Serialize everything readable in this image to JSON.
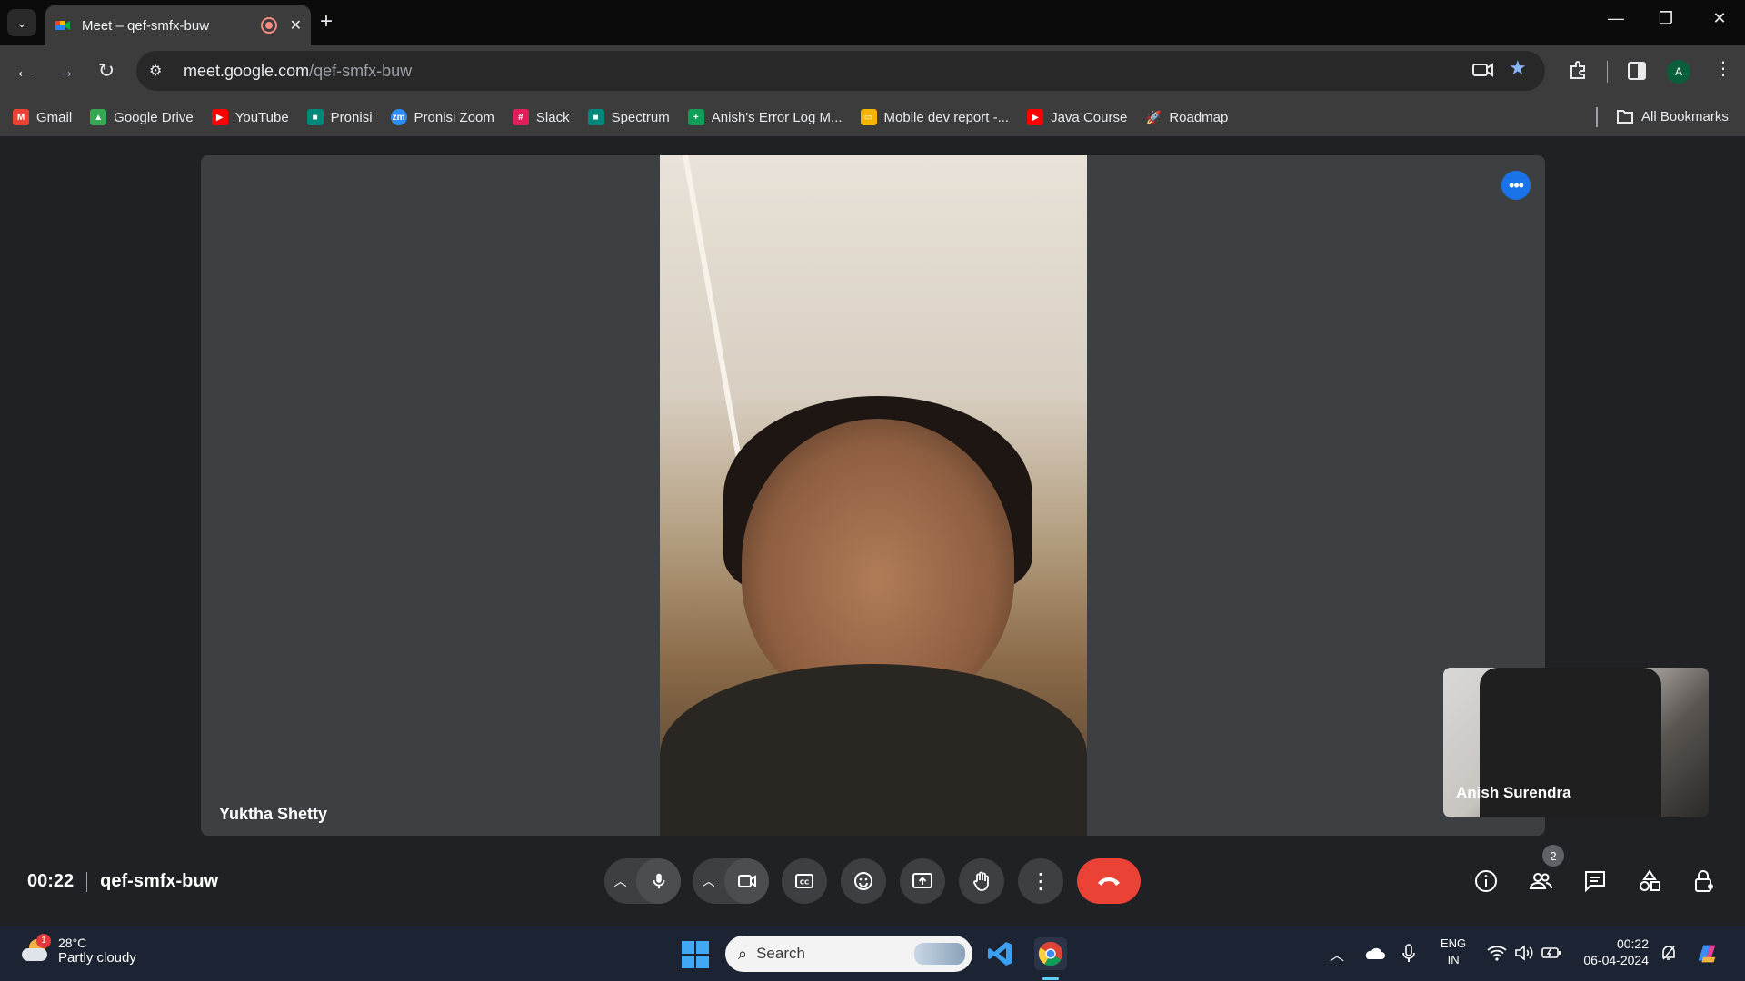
{
  "browser": {
    "tab_title": "Meet – qef-smfx-buw",
    "url_host": "meet.google.com",
    "url_path": "/qef-smfx-buw",
    "profile_initial": "A",
    "bookmarks": [
      {
        "label": "Gmail",
        "icon": "gmail-icon",
        "color": "#ea4335"
      },
      {
        "label": "Google Drive",
        "icon": "drive-icon",
        "color": "#34a853"
      },
      {
        "label": "YouTube",
        "icon": "youtube-icon",
        "color": "#ff0000"
      },
      {
        "label": "Pronisi",
        "icon": "meet-icon",
        "color": "#00897b"
      },
      {
        "label": "Pronisi Zoom",
        "icon": "zoom-icon",
        "color": "#2d8cff"
      },
      {
        "label": "Slack",
        "icon": "slack-icon",
        "color": "#e01e5a"
      },
      {
        "label": "Spectrum",
        "icon": "meet-icon",
        "color": "#00897b"
      },
      {
        "label": "Anish's Error Log M...",
        "icon": "sheets-icon",
        "color": "#0f9d58"
      },
      {
        "label": "Mobile dev report -...",
        "icon": "slides-icon",
        "color": "#f4b400"
      },
      {
        "label": "Java Course",
        "icon": "youtube-icon",
        "color": "#ff0000"
      },
      {
        "label": "Roadmap",
        "icon": "rocket-icon",
        "color": "#9aa0a6"
      }
    ],
    "all_bookmarks": "All Bookmarks"
  },
  "meet": {
    "main_participant": "Yuktha Shetty",
    "self_participant": "Anish Surendra",
    "elapsed": "00:22",
    "meeting_code": "qef-smfx-buw",
    "participants_count": "2",
    "hangup_color": "#ea4335",
    "more_button_color": "#1a73e8"
  },
  "taskbar": {
    "weather_temp": "28°C",
    "weather_desc": "Partly cloudy",
    "weather_badge": "1",
    "search_placeholder": "Search",
    "lang_line1": "ENG",
    "lang_line2": "IN",
    "time": "00:22",
    "date": "06-04-2024"
  }
}
